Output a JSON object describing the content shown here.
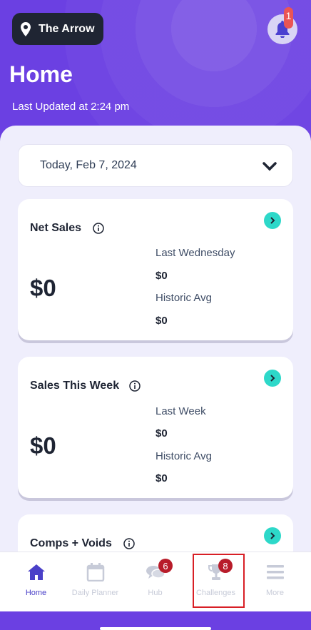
{
  "header": {
    "location_label": "The Arrow",
    "notification_count": "1",
    "title": "Home",
    "last_updated": "Last Updated at 2:24 pm"
  },
  "date_selector": {
    "value": "Today, Feb 7, 2024"
  },
  "cards": [
    {
      "title": "Net Sales",
      "value": "$0",
      "comparisons": [
        {
          "label": "Last Wednesday",
          "value": "$0"
        },
        {
          "label": "Historic Avg",
          "value": "$0"
        }
      ]
    },
    {
      "title": "Sales This Week",
      "value": "$0",
      "comparisons": [
        {
          "label": "Last Week",
          "value": "$0"
        },
        {
          "label": "Historic Avg",
          "value": "$0"
        }
      ]
    },
    {
      "title": "Comps + Voids"
    }
  ],
  "tabs": [
    {
      "label": "Home",
      "icon": "home-icon",
      "active": true
    },
    {
      "label": "Daily Planner",
      "icon": "calendar-icon"
    },
    {
      "label": "Hub",
      "icon": "chat-icon",
      "badge": "6"
    },
    {
      "label": "Challenges",
      "icon": "trophy-icon",
      "badge": "8"
    },
    {
      "label": "More",
      "icon": "menu-icon"
    }
  ],
  "colors": {
    "brand_purple": "#6b40e2",
    "accent_teal": "#2dd8c9",
    "badge_red": "#b81c2a",
    "active_tab": "#4a40c8"
  }
}
